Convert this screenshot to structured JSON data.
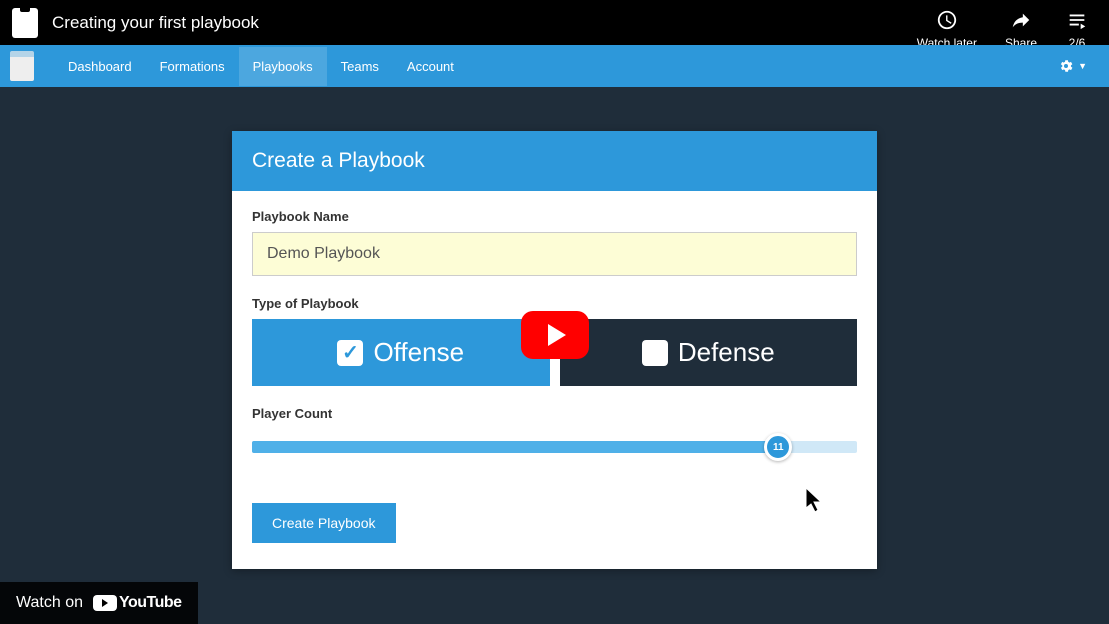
{
  "video": {
    "title": "Creating your first playbook",
    "watch_later": "Watch later",
    "share": "Share",
    "playlist_position": "2/6",
    "watch_on": "Watch on",
    "youtube_text": "YouTube"
  },
  "navbar": {
    "items": [
      {
        "label": "Dashboard"
      },
      {
        "label": "Formations"
      },
      {
        "label": "Playbooks"
      },
      {
        "label": "Teams"
      },
      {
        "label": "Account"
      }
    ],
    "active_index": 2
  },
  "form": {
    "panel_title": "Create a Playbook",
    "name_label": "Playbook Name",
    "name_value": "Demo Playbook",
    "type_label": "Type of Playbook",
    "offense_label": "Offense",
    "defense_label": "Defense",
    "player_count_label": "Player Count",
    "player_count_value": "11",
    "submit_label": "Create Playbook"
  },
  "colors": {
    "primary": "#2d98da",
    "dark": "#1f2d3a",
    "input_bg": "#fdfdd6"
  }
}
